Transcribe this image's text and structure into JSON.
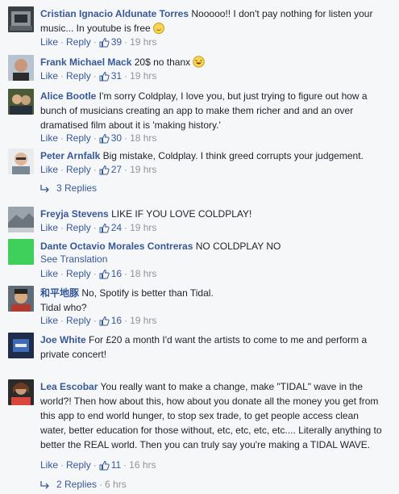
{
  "colors": {
    "link": "#365899",
    "meta": "#90949c",
    "text": "#1d2129",
    "background": "#f6f7f9"
  },
  "actions": {
    "like": "Like",
    "reply": "Reply"
  },
  "comments": [
    {
      "author": "Cristian Ignacio Aldunate Torres",
      "text": "Nooooo!! I don't pay nothing for listen your music... In youtube is free",
      "likes": "39",
      "time": "19 hrs",
      "avatar_icon": "avatar-photo"
    },
    {
      "author": "Frank Michael Mack",
      "text": "20$ no thanx",
      "likes": "31",
      "time": "19 hrs",
      "avatar_icon": "avatar-photo"
    },
    {
      "author": "Alice Bootle",
      "text": "I'm sorry Coldplay, I love you, but just trying to figure out how a bunch of musicians creating an app to make them richer and and an over dramatised film about it is 'making history.'",
      "likes": "30",
      "time": "18 hrs",
      "avatar_icon": "avatar-photo"
    },
    {
      "author": "Peter Arnfalk",
      "text": "Big mistake, Coldplay. I think greed corrupts your judgement.",
      "likes": "27",
      "time": "19 hrs",
      "avatar_icon": "avatar-photo"
    },
    {
      "author": "Freyja Stevens",
      "text": "LIKE IF YOU LOVE COLDPLAY!",
      "likes": "24",
      "time": "19 hrs",
      "avatar_icon": "avatar-photo"
    },
    {
      "author": "Dante Octavio Morales Contreras",
      "text": "NO COLDPLAY NO",
      "see_translation": "See Translation",
      "likes": "16",
      "time": "18 hrs",
      "avatar_icon": "avatar-photo"
    },
    {
      "author": "和平地豚",
      "text_line1": "No, Spotify is better than Tidal.",
      "text_line2": "Tidal who?",
      "likes": "16",
      "time": "19 hrs",
      "avatar_icon": "avatar-photo"
    },
    {
      "author": "Joe White",
      "text": "For £20 a month I'd want the artists to come to me and perform a private concert!",
      "avatar_icon": "avatar-photo"
    },
    {
      "author": "Lea Escobar",
      "text": "You really want to make a change, make \"TIDAL\" wave in the world?! Then how about this, how about you donate all the money you get from this app to end world hunger, to stop sex trade, to get people access clean water, better education for those without, etc, etc, etc, etc.... Literally anything to better the REAL world. Then you can truly say you're making a TIDAL WAVE.",
      "likes": "11",
      "time": "16 hrs",
      "avatar_icon": "avatar-photo"
    }
  ],
  "reply_threads": [
    {
      "label": "3 Replies"
    },
    {
      "label": "2 Replies",
      "time": "6 hrs"
    }
  ]
}
